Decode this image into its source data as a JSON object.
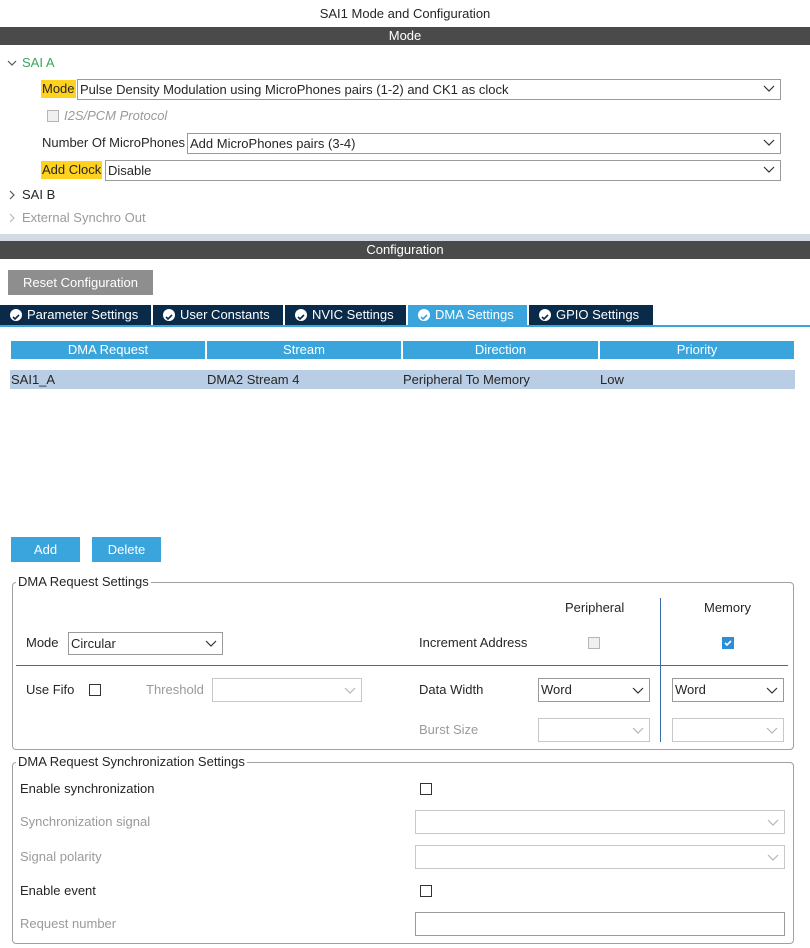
{
  "window_title": "SAI1 Mode and Configuration",
  "mode_section": {
    "header": "Mode",
    "sai_a": "SAI A",
    "mode_label": "Mode",
    "mode_value": "Pulse Density Modulation using MicroPhones pairs (1-2) and CK1 as clock",
    "i2s_pcm_protocol": "I2S/PCM Protocol",
    "num_mic_label": "Number Of MicroPhones",
    "num_mic_value": "Add MicroPhones pairs (3-4)",
    "add_clock_label": "Add Clock",
    "add_clock_value": "Disable",
    "sai_b": "SAI B",
    "external_synchro_out": "External Synchro Out"
  },
  "configuration": {
    "header": "Configuration",
    "reset_button": "Reset Configuration",
    "tabs": [
      {
        "label": "Parameter Settings",
        "active": false
      },
      {
        "label": "User Constants",
        "active": false
      },
      {
        "label": "NVIC Settings",
        "active": false
      },
      {
        "label": "DMA Settings",
        "active": true
      },
      {
        "label": "GPIO Settings",
        "active": false
      }
    ]
  },
  "dma_table": {
    "columns": [
      "DMA Request",
      "Stream",
      "Direction",
      "Priority"
    ],
    "rows": [
      [
        "SAI1_A",
        "DMA2 Stream 4",
        "Peripheral To Memory",
        "Low"
      ]
    ],
    "add_button": "Add",
    "delete_button": "Delete"
  },
  "dma_request_settings": {
    "title": "DMA Request Settings",
    "peripheral_header": "Peripheral",
    "memory_header": "Memory",
    "mode_label": "Mode",
    "mode_value": "Circular",
    "increment_address_label": "Increment Address",
    "peripheral_increment_checked": false,
    "memory_increment_checked": true,
    "use_fifo_label": "Use Fifo",
    "use_fifo_checked": false,
    "threshold_label": "Threshold",
    "threshold_value": "",
    "data_width_label": "Data Width",
    "peripheral_data_width": "Word",
    "memory_data_width": "Word",
    "burst_size_label": "Burst Size",
    "peripheral_burst_size": "",
    "memory_burst_size": ""
  },
  "sync_settings": {
    "title": "DMA Request Synchronization Settings",
    "enable_sync_label": "Enable synchronization",
    "enable_sync_checked": false,
    "sync_signal_label": "Synchronization signal",
    "sync_signal_value": "",
    "signal_polarity_label": "Signal polarity",
    "signal_polarity_value": "",
    "enable_event_label": "Enable event",
    "enable_event_checked": false,
    "request_number_label": "Request number",
    "request_number_value": ""
  },
  "colors": {
    "accent_blue": "#3aa5dc",
    "dark_tab": "#0a2a4a",
    "highlight_yellow": "#ffd21f",
    "section_green": "#3aa55a",
    "header_bar": "#4a4a4a",
    "row_selected": "#b9cde5"
  }
}
